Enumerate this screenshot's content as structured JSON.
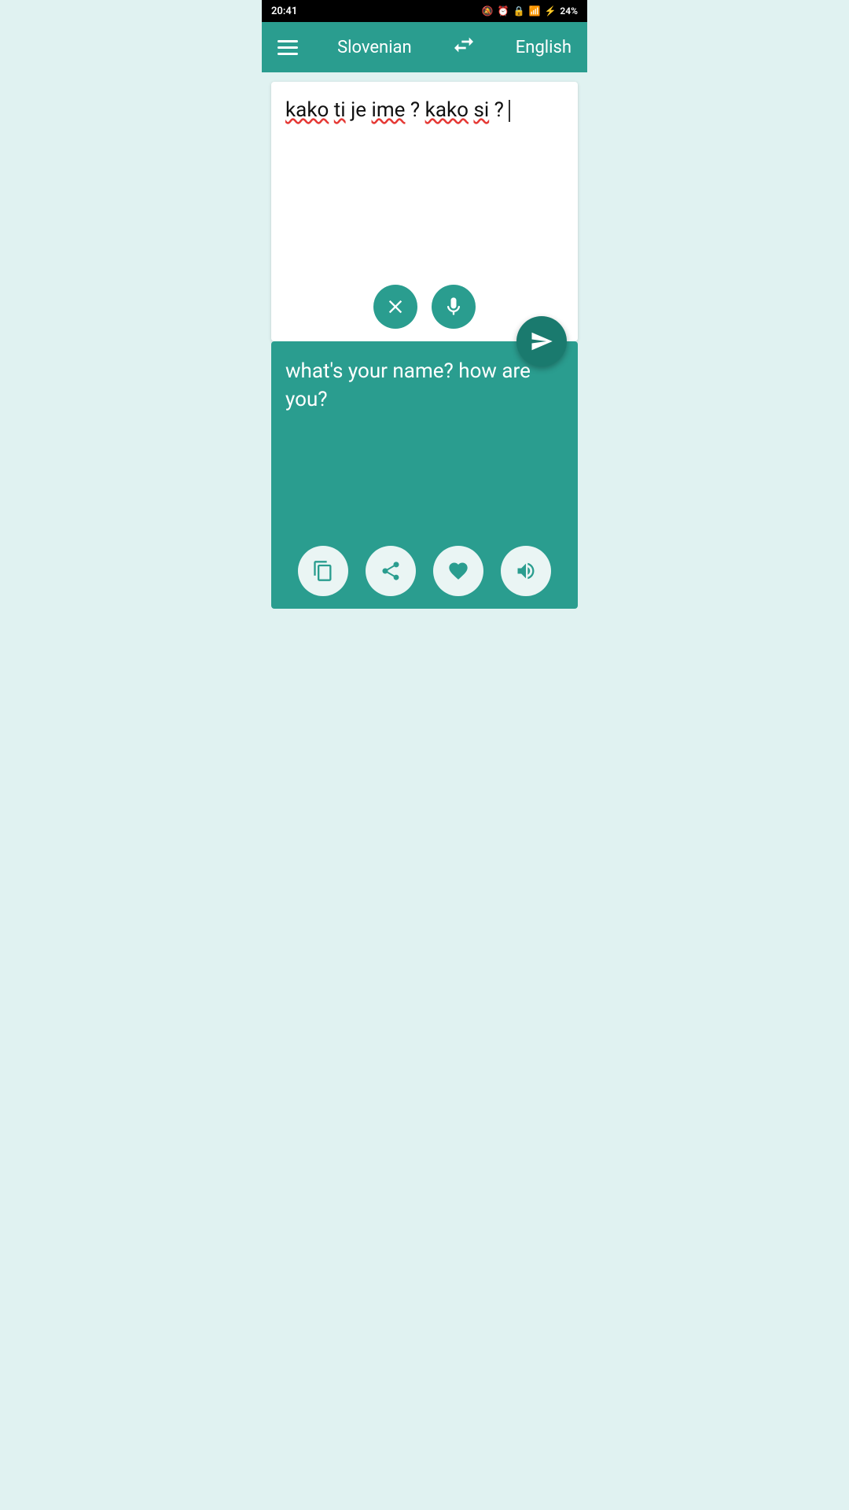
{
  "statusBar": {
    "time": "20:41",
    "battery": "24%"
  },
  "toolbar": {
    "menuLabel": "menu",
    "sourceLang": "Slovenian",
    "swapLabel": "swap",
    "targetLang": "English"
  },
  "sourcePanel": {
    "inputText": "kako ti je ime? kako si?",
    "clearLabel": "clear",
    "micLabel": "microphone"
  },
  "translateButton": {
    "label": "translate"
  },
  "translationPanel": {
    "outputText": "what's your name? how are you?",
    "copyLabel": "copy",
    "shareLabel": "share",
    "favoriteLabel": "favorite",
    "speakLabel": "speak"
  },
  "colors": {
    "teal": "#2a9d8f",
    "darkTeal": "#1a7a6e",
    "white": "#ffffff",
    "background": "#e0f2f1"
  }
}
